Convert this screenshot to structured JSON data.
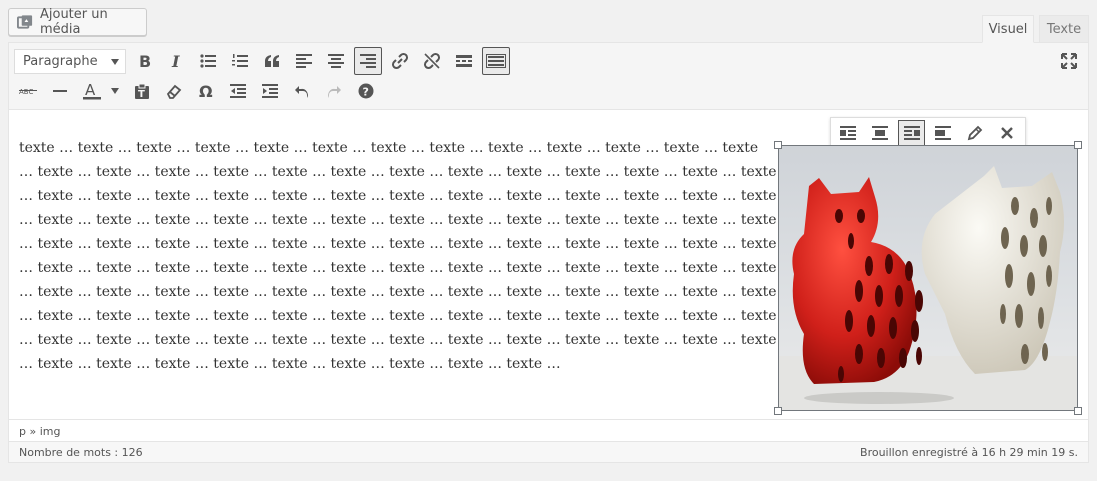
{
  "media_button": {
    "label": "Ajouter un média",
    "icon": "add-media-icon"
  },
  "tabs": {
    "visual": "Visuel",
    "text": "Texte"
  },
  "format_select": {
    "value": "Paragraphe"
  },
  "paragraph": {
    "lines": [
      "texte … texte … texte … texte … texte … texte … texte … texte … texte … texte … texte … texte … texte",
      "… texte … texte … texte … texte … texte … texte … texte … texte … texte … texte … texte … texte … texte",
      "… texte … texte … texte … texte … texte … texte … texte … texte … texte … texte … texte … texte … texte",
      "… texte … texte … texte … texte … texte … texte … texte … texte … texte … texte … texte … texte … texte",
      "… texte … texte … texte … texte … texte … texte … texte … texte … texte … texte … texte … texte … texte",
      "… texte … texte … texte … texte … texte … texte … texte … texte … texte … texte … texte … texte … texte",
      "… texte … texte … texte … texte … texte … texte … texte … texte … texte … texte … texte … texte … texte",
      "… texte … texte … texte … texte … texte … texte … texte … texte … texte … texte … texte … texte … texte",
      "… texte … texte … texte … texte … texte … texte … texte … texte … texte … texte … texte … texte … texte",
      "… texte … texte … texte … texte … texte … texte … texte … texte … texte …"
    ]
  },
  "path": "p » img",
  "word_count": "Nombre de mots : 126",
  "draft_status": "Brouillon enregistré à 16 h 29 min 19 s.",
  "image": {
    "subject": "red and white ceramic cats"
  },
  "colors": {
    "accent": "#555555",
    "cat_red": "#d0201a",
    "cat_white": "#ece8de"
  }
}
